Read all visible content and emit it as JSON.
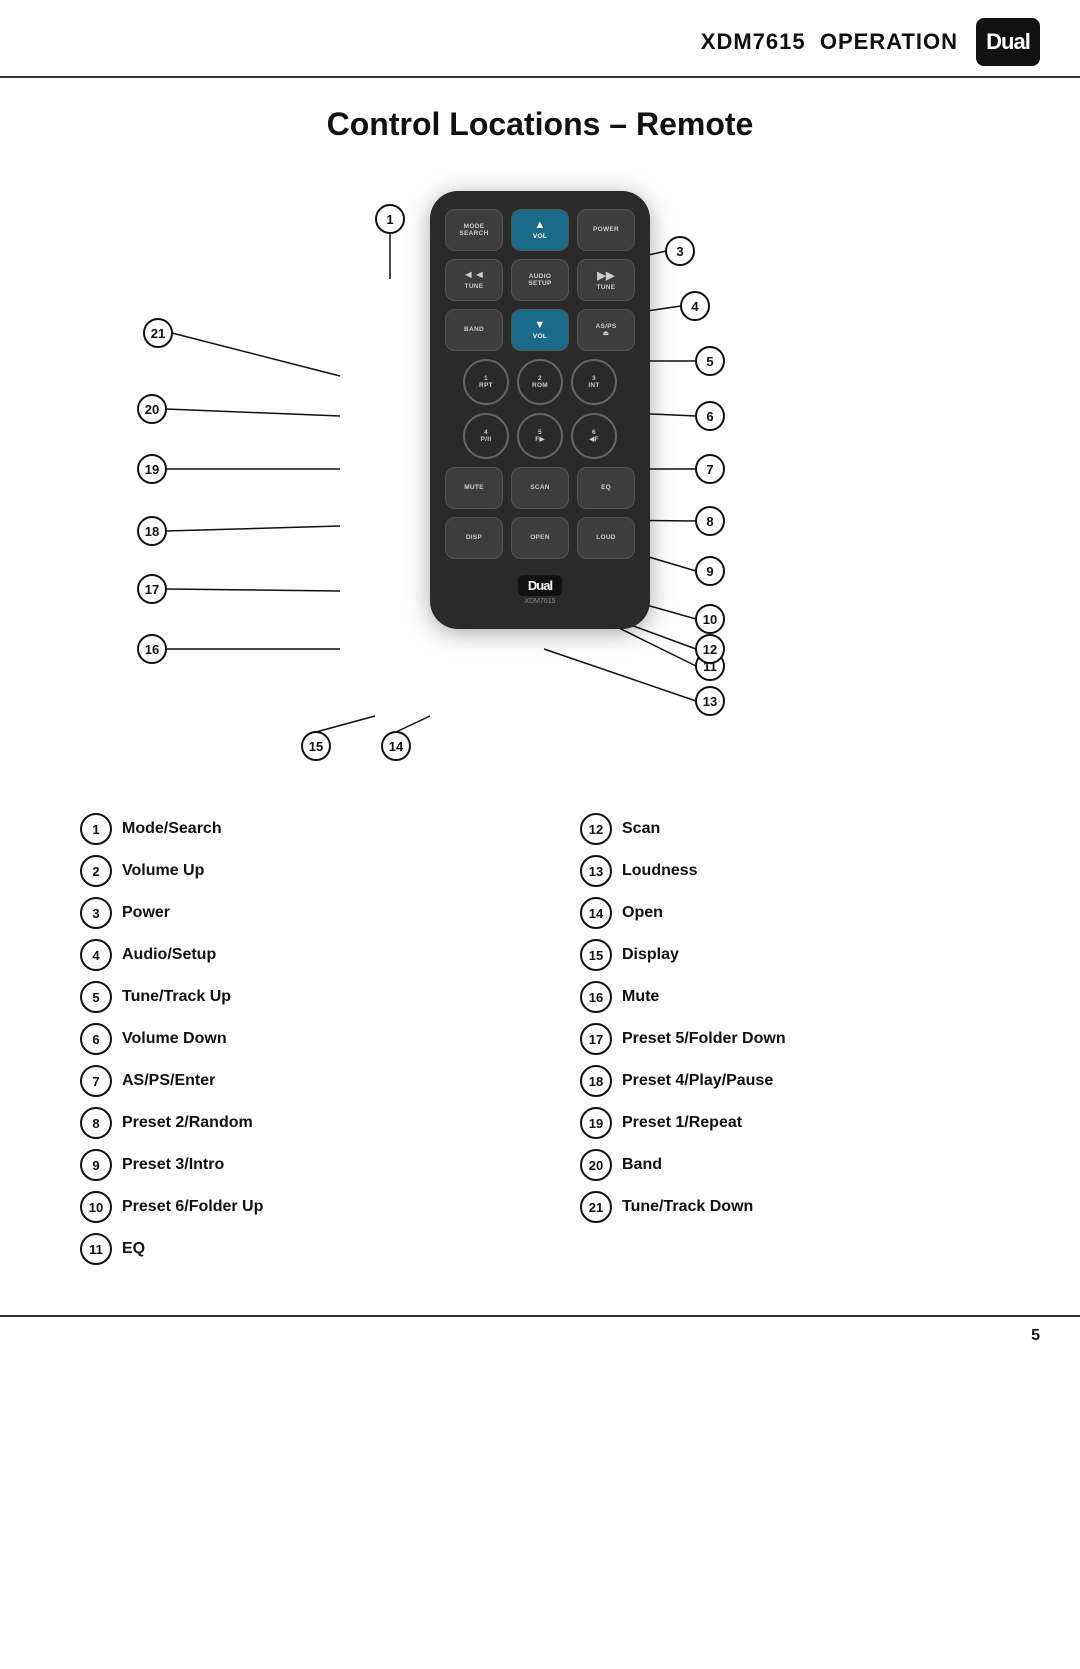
{
  "header": {
    "model": "XDM7615",
    "section": "OPERATION",
    "logo": "Dual"
  },
  "page_title": "Control Locations – Remote",
  "remote": {
    "buttons": [
      {
        "row": 1,
        "label": "MODE\nSEARCH",
        "icon": ""
      },
      {
        "row": 1,
        "label": "VOL",
        "icon": "▲",
        "type": "vol"
      },
      {
        "row": 1,
        "label": "POWER",
        "icon": ""
      },
      {
        "row": 2,
        "label": "◄◄\nTUNE",
        "icon": ""
      },
      {
        "row": 2,
        "label": "AUDIO\nSETUP",
        "icon": ""
      },
      {
        "row": 2,
        "label": "TUNE\n▶▶",
        "icon": ""
      },
      {
        "row": 3,
        "label": "BAND",
        "icon": ""
      },
      {
        "row": 3,
        "label": "VOL",
        "icon": "▼",
        "type": "vol"
      },
      {
        "row": 3,
        "label": "AS/PS\n⏏",
        "icon": ""
      },
      {
        "row": 4,
        "label": "1\nRPT",
        "icon": ""
      },
      {
        "row": 4,
        "label": "2\nROM",
        "icon": ""
      },
      {
        "row": 4,
        "label": "3\nINT",
        "icon": ""
      },
      {
        "row": 5,
        "label": "4\nP/II",
        "icon": ""
      },
      {
        "row": 5,
        "label": "5\nF▶",
        "icon": ""
      },
      {
        "row": 5,
        "label": "6\n◀F",
        "icon": ""
      },
      {
        "row": 6,
        "label": "MUTE",
        "icon": ""
      },
      {
        "row": 6,
        "label": "SCAN",
        "icon": ""
      },
      {
        "row": 6,
        "label": "EQ",
        "icon": ""
      },
      {
        "row": 7,
        "label": "DISP",
        "icon": ""
      },
      {
        "row": 7,
        "label": "OPEN",
        "icon": ""
      },
      {
        "row": 7,
        "label": "LOUD",
        "icon": ""
      }
    ]
  },
  "legend": {
    "left": [
      {
        "num": "1",
        "label": "Mode/Search"
      },
      {
        "num": "2",
        "label": "Volume Up"
      },
      {
        "num": "3",
        "label": "Power"
      },
      {
        "num": "4",
        "label": "Audio/Setup"
      },
      {
        "num": "5",
        "label": "Tune/Track Up"
      },
      {
        "num": "6",
        "label": "Volume Down"
      },
      {
        "num": "7",
        "label": "AS/PS/Enter"
      },
      {
        "num": "8",
        "label": "Preset 2/Random"
      },
      {
        "num": "9",
        "label": "Preset 3/Intro"
      },
      {
        "num": "10",
        "label": "Preset 6/Folder Up"
      },
      {
        "num": "11",
        "label": "EQ"
      }
    ],
    "right": [
      {
        "num": "12",
        "label": "Scan"
      },
      {
        "num": "13",
        "label": "Loudness"
      },
      {
        "num": "14",
        "label": "Open"
      },
      {
        "num": "15",
        "label": "Display"
      },
      {
        "num": "16",
        "label": "Mute"
      },
      {
        "num": "17",
        "label": "Preset 5/Folder Down"
      },
      {
        "num": "18",
        "label": "Preset 4/Play/Pause"
      },
      {
        "num": "19",
        "label": "Preset 1/Repeat"
      },
      {
        "num": "20",
        "label": "Band"
      },
      {
        "num": "21",
        "label": "Tune/Track Down"
      }
    ]
  },
  "footer": {
    "page_number": "5"
  }
}
